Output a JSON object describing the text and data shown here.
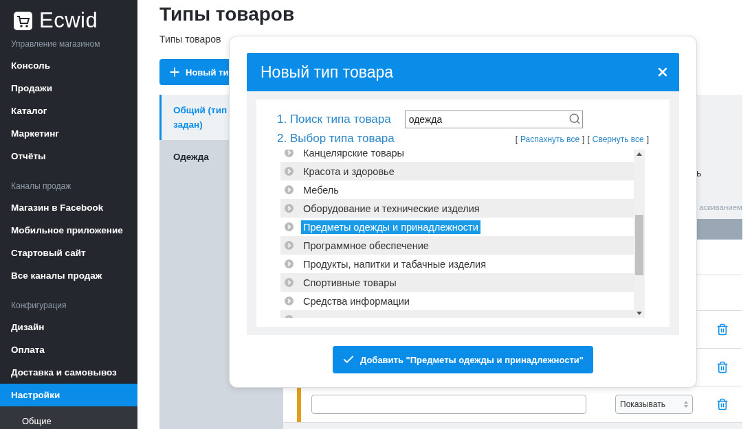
{
  "sidebar": {
    "logo": "Ecwid",
    "sections": [
      {
        "heading": "Управление магазином",
        "items": [
          {
            "label": "Консоль",
            "selected": false
          },
          {
            "label": "Продажи",
            "selected": false
          },
          {
            "label": "Каталог",
            "selected": false
          },
          {
            "label": "Маркетинг",
            "selected": false
          },
          {
            "label": "Отчёты",
            "selected": false
          }
        ]
      },
      {
        "heading": "Каналы продаж",
        "items": [
          {
            "label": "Магазин в Facebook",
            "selected": false
          },
          {
            "label": "Мобильное приложение",
            "selected": false
          },
          {
            "label": "Стартовый сайт",
            "selected": false
          },
          {
            "label": "Все каналы продаж",
            "selected": false
          }
        ]
      },
      {
        "heading": "Конфигурация",
        "items": [
          {
            "label": "Дизайн",
            "selected": false
          },
          {
            "label": "Оплата",
            "selected": false
          },
          {
            "label": "Доставка и самовывоз",
            "selected": false
          },
          {
            "label": "Настройки",
            "selected": true,
            "children": [
              {
                "label": "Общие",
                "selected": false
              }
            ]
          }
        ]
      }
    ]
  },
  "page": {
    "title": "Типы товаров",
    "subtitle": "Типы товаров",
    "new_button": "Новый ти",
    "type_list": [
      {
        "label": "Общий (тип задан)",
        "selected": true
      },
      {
        "label": "Одежда",
        "selected": false
      }
    ],
    "table": {
      "fragment_1": "ь",
      "fragment_2": "аскиванием",
      "rows": [
        {
          "kind": "blank"
        },
        {
          "kind": "blank"
        },
        {
          "kind": "trash"
        },
        {
          "kind": "trash"
        },
        {
          "kind": "edit",
          "select": "Показывать"
        }
      ]
    }
  },
  "modal": {
    "title": "Новый тип товара",
    "step_1": "1. Поиск типа товара",
    "search": {
      "value": "одежда"
    },
    "step_2": "2. Выбор типа товара",
    "bracket_open": "[",
    "bracket_close": "]",
    "links": [
      "Распахнуть все",
      "Свернуть все"
    ],
    "categories": [
      {
        "label": "Канцелярские товары",
        "selected": false
      },
      {
        "label": "Красота и здоровье",
        "selected": false
      },
      {
        "label": "Мебель",
        "selected": false
      },
      {
        "label": "Оборудование и технические изделия",
        "selected": false
      },
      {
        "label": "Предметы одежды и принадлежности",
        "selected": true
      },
      {
        "label": "Программное обеспечение",
        "selected": false
      },
      {
        "label": "Продукты, напитки и табачные изделия",
        "selected": false
      },
      {
        "label": "Спортивные товары",
        "selected": false
      },
      {
        "label": "Средства информации",
        "selected": false
      }
    ],
    "add_button": "Добавить \"Предметы одежды и принадлежности\""
  }
}
